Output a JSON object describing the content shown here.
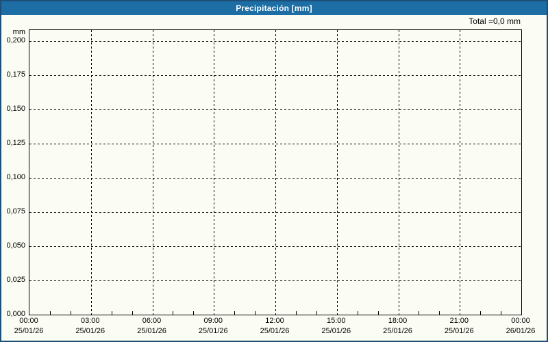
{
  "title_bar": {
    "text": "Precipitación [mm]",
    "bg": "#1c6ea4",
    "fg": "#ffffff"
  },
  "total_label": "Total =0,0 mm",
  "colors": {
    "frame_border": "#1d4f79",
    "title_bg": "#1c6ea4",
    "plot_bg": "#fbfdf4",
    "grid": "#000000",
    "axis": "#000000",
    "tick_text": "#000000"
  },
  "chart_data": {
    "type": "bar",
    "title": "Precipitación [mm]",
    "xlabel": "",
    "ylabel": "mm",
    "ylim": [
      0,
      0.208
    ],
    "grid": "dashed",
    "legend": "none",
    "total_annotation": "Total =0,0 mm",
    "y_ticks": [
      {
        "value": 0.2,
        "label": "0,200"
      },
      {
        "value": 0.175,
        "label": "0,175"
      },
      {
        "value": 0.15,
        "label": "0,150"
      },
      {
        "value": 0.125,
        "label": "0,125"
      },
      {
        "value": 0.1,
        "label": "0,100"
      },
      {
        "value": 0.075,
        "label": "0,075"
      },
      {
        "value": 0.05,
        "label": "0,050"
      },
      {
        "value": 0.025,
        "label": "0,025"
      },
      {
        "value": 0.0,
        "label": "0,000"
      }
    ],
    "x_ticks": [
      {
        "time": "00:00",
        "date": "25/01/26"
      },
      {
        "time": "03:00",
        "date": "25/01/26"
      },
      {
        "time": "06:00",
        "date": "25/01/26"
      },
      {
        "time": "09:00",
        "date": "25/01/26"
      },
      {
        "time": "12:00",
        "date": "25/01/26"
      },
      {
        "time": "15:00",
        "date": "25/01/26"
      },
      {
        "time": "18:00",
        "date": "25/01/26"
      },
      {
        "time": "21:00",
        "date": "25/01/26"
      },
      {
        "time": "00:00",
        "date": "26/01/26"
      }
    ],
    "x_minor_ticks_per_major_interval": 3,
    "series": [
      {
        "name": "Precipitación",
        "values": [
          0,
          0,
          0,
          0,
          0,
          0,
          0,
          0
        ],
        "unit": "mm"
      }
    ],
    "total": "0,0 mm"
  }
}
